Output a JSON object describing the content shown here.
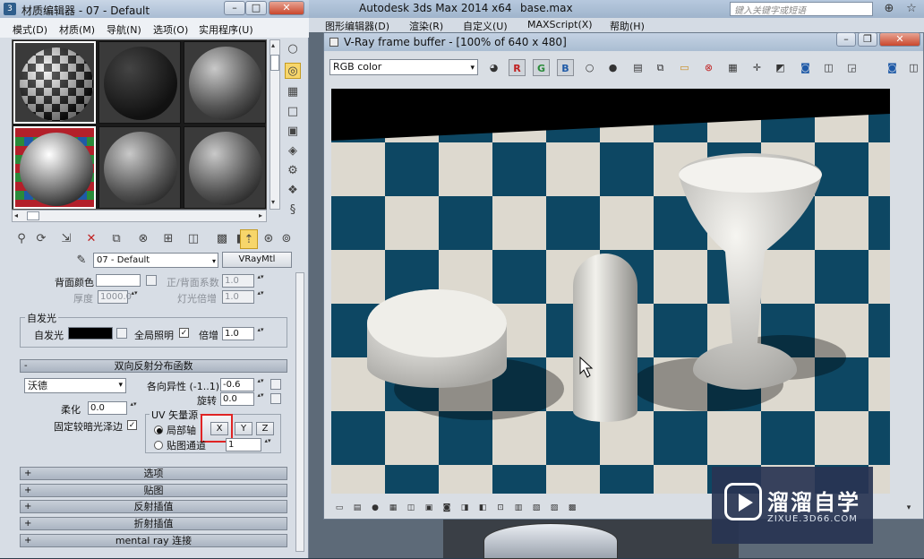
{
  "max_window": {
    "app_title": "Autodesk 3ds Max  2014 x64",
    "file_name": "base.max",
    "search_placeholder": "键入关键字或短语",
    "menu": [
      "图形编辑器(D)",
      "渲染(R)",
      "自定义(U)",
      "MAXScript(X)",
      "帮助(H)"
    ]
  },
  "material_editor": {
    "title": "材质编辑器 - 07 - Default",
    "menu": [
      "模式(D)",
      "材质(M)",
      "导航(N)",
      "选项(O)",
      "实用程序(U)"
    ],
    "current_material": "07 - Default",
    "material_type": "VRayMtl",
    "back_color": {
      "label": "背面颜色",
      "fresnel_label": "正/背面系数",
      "fresnel_value": "1.0",
      "thickness_label": "厚度",
      "thickness_value": "1000.0",
      "light_mult_label": "灯光倍增",
      "light_mult_value": "1.0"
    },
    "self_illum": {
      "group": "自发光",
      "label": "自发光",
      "gi_label": "全局照明",
      "gi_checked": "✓",
      "mult_label": "倍增",
      "mult_value": "1.0"
    },
    "brdf": {
      "header": "双向反射分布函数",
      "type": "沃德",
      "anisotropy_label": "各向异性 (-1..1)",
      "anisotropy_value": "-0.6",
      "rotation_label": "旋转",
      "rotation_value": "0.0",
      "soften_label": "柔化",
      "soften_value": "0.0",
      "fix_dark_label": "固定较暗光泽边",
      "fix_dark_checked": "✓",
      "uv_group": "UV 矢量源",
      "local_axis_label": "局部轴",
      "map_channel_label": "贴图通道",
      "map_channel_value": "1",
      "axes": [
        "X",
        "Y",
        "Z"
      ]
    },
    "rollouts": [
      "选项",
      "贴图",
      "反射插值",
      "折射插值",
      "mental ray 连接"
    ],
    "plus": "+",
    "minus": "-"
  },
  "vfb": {
    "title": "V-Ray frame buffer - [100% of 640 x 480]",
    "channel": "RGB color",
    "rgb_buttons": [
      "R",
      "G",
      "B"
    ]
  },
  "icons": {
    "dropdown": "▾",
    "scroll_left": "◂",
    "scroll_right": "▸",
    "scroll_up": "▴",
    "scroll_down": "▾",
    "spin": "▴▾",
    "binoculars": "⊕",
    "star": "☆"
  },
  "watermark": {
    "cn": "溜溜自学",
    "en": "ZIXUE.3D66.COM"
  },
  "colors": {
    "floor_blue": "#0d4763",
    "floor_cream": "#ddd9cf",
    "accent_highlight": "#e02424"
  }
}
